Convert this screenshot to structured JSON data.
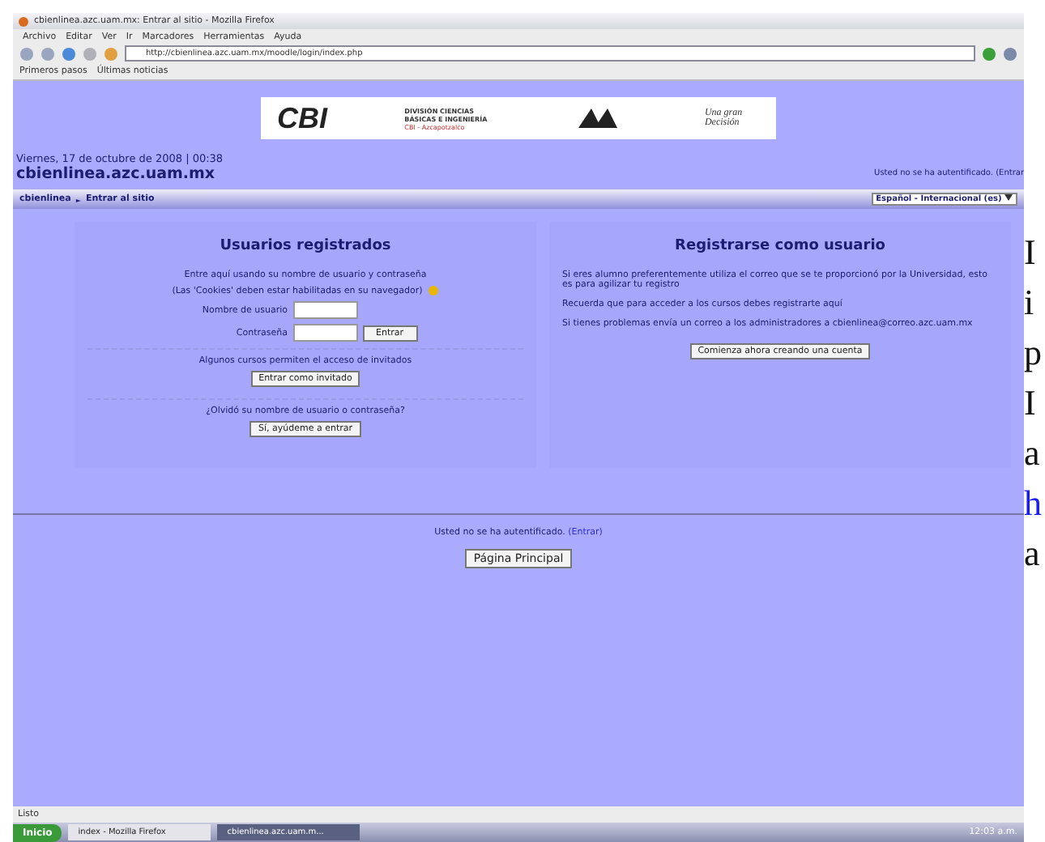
{
  "window": {
    "title": "cbienlinea.azc.uam.mx: Entrar al sitio - Mozilla Firefox"
  },
  "menu": [
    "Archivo",
    "Editar",
    "Ver",
    "Ir",
    "Marcadores",
    "Herramientas",
    "Ayuda"
  ],
  "address": "http://cbienlinea.azc.uam.mx/moodle/login/index.php",
  "bookmarks": [
    "Primeros pasos",
    "Últimas noticias"
  ],
  "banner": {
    "brand": "CBI",
    "division": "DIVISIÓN CIENCIAS BÁSICAS E INGENIERÍA",
    "campus": "CBI - Azcapotzalco",
    "motto": "Una gran Decisión"
  },
  "header": {
    "date": "Viernes, 17 de octubre de 2008 | 00:38",
    "site": "cbienlinea.azc.uam.mx",
    "login_info": "Usted no se ha autentificado. (Entrar"
  },
  "breadcrumb": [
    "cbienlinea",
    "►",
    "Entrar al sitio"
  ],
  "language": "Español - Internacional (es)",
  "login": {
    "title": "Usuarios registrados",
    "intro": "Entre aquí usando su nombre de usuario y contraseña",
    "cookies": "(Las 'Cookies' deben estar habilitadas en su navegador)",
    "username_label": "Nombre de usuario",
    "password_label": "Contraseña",
    "submit": "Entrar",
    "guest_text": "Algunos cursos permiten el acceso de invitados",
    "guest_button": "Entrar como invitado",
    "forgot_text": "¿Olvidó su nombre de usuario o contraseña?",
    "forgot_button": "Sí, ayúdeme a entrar"
  },
  "register": {
    "title": "Registrarse como usuario",
    "paragraphs": [
      "Si eres alumno preferentemente utiliza el correo que se te proporcionó por la Universidad, esto es para agilizar tu registro",
      "Recuerda que para acceder a los cursos debes registrarte aquí",
      "Si tienes problemas envía un correo a los administradores a cbienlinea@correo.azc.uam.mx"
    ],
    "button": "Comienza ahora creando una cuenta"
  },
  "footer": {
    "login_info": "Usted no se ha autentificado.",
    "login_link": "(Entrar)",
    "home_button": "Página Principal"
  },
  "status_bar": "Listo",
  "taskbar": {
    "start": "Inicio",
    "tasks": [
      {
        "label": "index - Mozilla Firefox",
        "selected": false
      },
      {
        "label": "cbienlinea.azc.uam.m...",
        "selected": true
      }
    ],
    "clock": "12:03 a.m."
  },
  "doc_fragments": [
    {
      "text": "I",
      "kind": "text"
    },
    {
      "text": "i",
      "kind": "text"
    },
    {
      "text": "p",
      "kind": "text"
    },
    {
      "text": "I",
      "kind": "text"
    },
    {
      "text": "a",
      "kind": "text"
    },
    {
      "text": "h",
      "kind": "link"
    },
    {
      "text": "a",
      "kind": "text"
    }
  ]
}
